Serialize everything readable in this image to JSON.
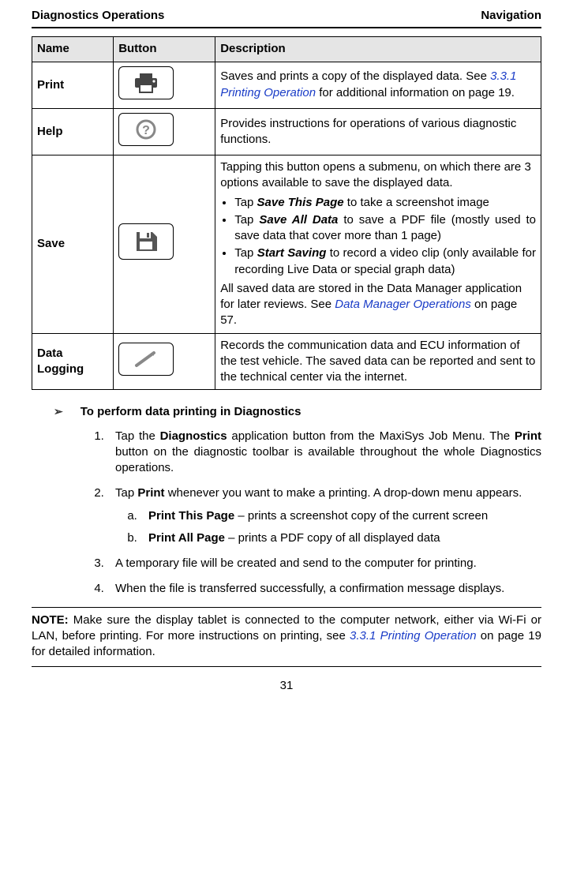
{
  "header": {
    "left": "Diagnostics Operations",
    "right": "Navigation"
  },
  "table": {
    "headers": {
      "name": "Name",
      "button": "Button",
      "description": "Description"
    },
    "rows": {
      "print": {
        "name": "Print",
        "desc_pre": "Saves and prints a copy of the displayed data. See ",
        "desc_link": "3.3.1 Printing Operation",
        "desc_post": " for additional information on page 19."
      },
      "help": {
        "name": "Help",
        "desc": "Provides instructions for operations of various diagnostic functions."
      },
      "save": {
        "name": "Save",
        "intro": "Tapping this button opens a submenu, on which there are 3 options available to save the displayed data.",
        "b1_pre": "Tap ",
        "b1_bold": "Save This Page",
        "b1_post": " to take a screenshot image",
        "b2_pre": "Tap ",
        "b2_bold": "Save All Data",
        "b2_post": " to save a PDF file (mostly used to save data that cover more than 1 page)",
        "b3_pre": "Tap ",
        "b3_bold": "Start Saving",
        "b3_post": " to record a video clip (only available for recording Live Data or special graph data)",
        "out_pre": "All saved data are stored in the Data Manager application for later reviews. See ",
        "out_link": "Data Manager Operations",
        "out_post": " on page 57."
      },
      "dlog": {
        "name": "Data Logging",
        "desc": "Records the communication data and ECU information of the test vehicle. The saved data can be reported and sent to the technical center via the internet."
      }
    }
  },
  "heading": "To perform data printing in Diagnostics",
  "steps": {
    "s1_pre": "Tap the ",
    "s1_b": "Diagnostics",
    "s1_mid": " application button from the MaxiSys Job Menu. The ",
    "s1_b2": "Print",
    "s1_post": " button on the diagnostic toolbar is available throughout the whole Diagnostics operations.",
    "s2_pre": "Tap ",
    "s2_b": "Print",
    "s2_post": " whenever you want to make a printing. A drop-down menu appears.",
    "s2a_b": "Print This Page",
    "s2a_post": " – prints a screenshot copy of the current screen",
    "s2b_b": "Print All Page",
    "s2b_post": " – prints a PDF copy of all displayed data",
    "s3": "A temporary file will be created and send to the computer for printing.",
    "s4": "When the file is transferred successfully, a confirmation message displays."
  },
  "note": {
    "label": "NOTE:",
    "pre": " Make sure the display tablet is connected to the computer network, either via Wi-Fi or LAN, before printing. For more instructions on printing, see ",
    "link": "3.3.1 Printing Operation",
    "post": " on page 19 for detailed information."
  },
  "page_number": "31"
}
